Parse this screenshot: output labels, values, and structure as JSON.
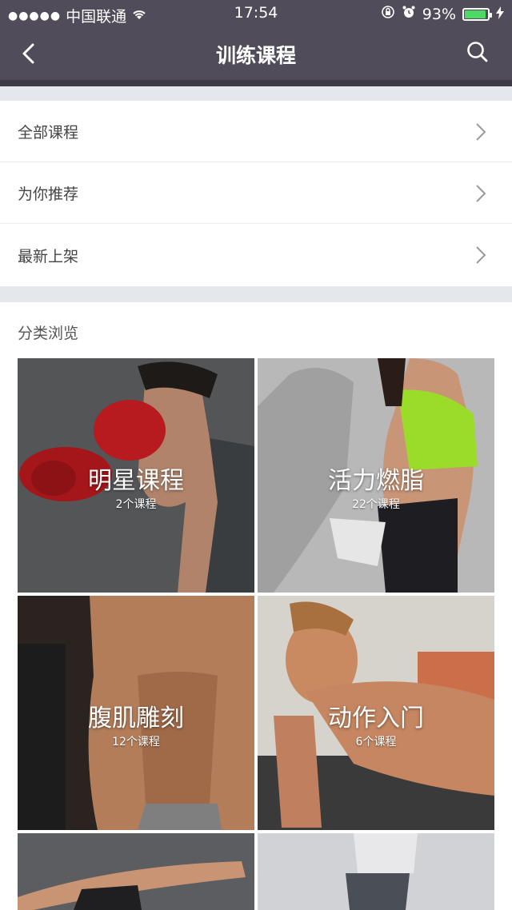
{
  "status_bar": {
    "carrier": "中国联通",
    "time": "17:54",
    "battery": "93%",
    "battery_level": 0.93
  },
  "nav": {
    "title": "训练课程",
    "back_icon": "chevron-left-icon",
    "search_icon": "search-icon"
  },
  "menu": {
    "items": [
      {
        "label": "全部课程"
      },
      {
        "label": "为你推荐"
      },
      {
        "label": "最新上架"
      }
    ]
  },
  "categories": {
    "title": "分类浏览",
    "tiles": [
      {
        "title": "明星课程",
        "count": "2个课程"
      },
      {
        "title": "活力燃脂",
        "count": "22个课程"
      },
      {
        "title": "腹肌雕刻",
        "count": "12个课程"
      },
      {
        "title": "动作入门",
        "count": "6个课程"
      },
      {
        "title": "",
        "count": ""
      },
      {
        "title": "",
        "count": ""
      }
    ]
  },
  "colors": {
    "nav_bg": "#514c5a",
    "battery_green": "#4cd964",
    "divider": "#e4e8ec"
  }
}
